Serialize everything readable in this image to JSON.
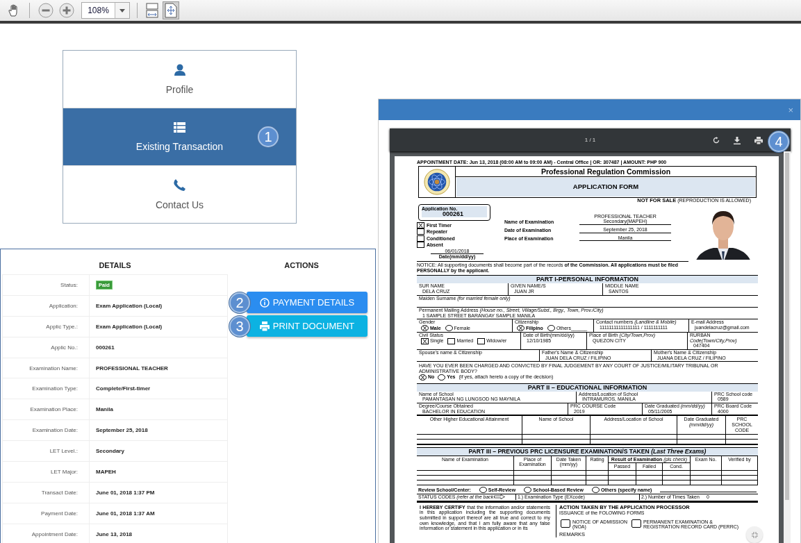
{
  "toolbar": {
    "zoom": "108%",
    "view_buttons": [
      {
        "selected": false
      },
      {
        "selected": true
      }
    ]
  },
  "menu": [
    {
      "label": "Profile",
      "selected": false
    },
    {
      "label": "Existing Transaction",
      "selected": true,
      "callout": "1"
    },
    {
      "label": "Contact Us",
      "selected": false
    }
  ],
  "details": {
    "heading": "DETAILS",
    "rows": [
      {
        "label": "Status:",
        "value": "Paid",
        "kind": "badge"
      },
      {
        "label": "Application:",
        "value": "Exam Application (Local)",
        "kind": "text"
      },
      {
        "label": "Applic Type.:",
        "value": "Exam Application (Local)",
        "kind": "text"
      },
      {
        "label": "Applic No.:",
        "value": "000261",
        "kind": "text"
      },
      {
        "label": "Examination Name:",
        "value": "PROFESSIONAL TEACHER",
        "kind": "text"
      },
      {
        "label": "Examination Type:",
        "value": "Complete/First-timer",
        "kind": "text"
      },
      {
        "label": "Examination Place:",
        "value": "Manila",
        "kind": "text"
      },
      {
        "label": "Examination Date:",
        "value": "September 25, 2018",
        "kind": "text"
      },
      {
        "label": "LET Level.:",
        "value": "Secondary",
        "kind": "text"
      },
      {
        "label": "LET Major:",
        "value": "MAPEH",
        "kind": "text"
      },
      {
        "label": "Transact Date:",
        "value": "June 01, 2018 1:37 PM",
        "kind": "text"
      },
      {
        "label": "Payment Date:",
        "value": "June 01, 2018 1:37 AM",
        "kind": "text"
      },
      {
        "label": "Appointment Date:",
        "value": "June 13, 2018",
        "kind": "text"
      }
    ]
  },
  "actions": {
    "heading": "ACTIONS",
    "buttons": [
      {
        "label": "PAYMENT DETAILS",
        "kind": "info",
        "callout": "2"
      },
      {
        "label": "PRINT DOCUMENT",
        "kind": "print",
        "callout": "3"
      }
    ]
  },
  "modal": {
    "close": "×"
  },
  "viewer": {
    "page_indicator": "1 / 1",
    "callout": "4"
  },
  "document": {
    "appointment": "APPOINTMENT DATE: Jun 13, 2018 (08:00 AM to 09:00 AM) - Central Office | OR: 307487 | AMOUNT: PHP 900",
    "organization": "Professional Regulation Commission",
    "form_title": "APPLICATION FORM",
    "not_for_sale": "NOT FOR SALE",
    "reproduction_note": "(REPRODUCTION IS ALLOWED)",
    "application_no_label": "Application  No.",
    "application_no": "000261",
    "applicant_types": [
      {
        "label": "First Timer",
        "checked": true
      },
      {
        "label": "Repeater",
        "checked": false
      },
      {
        "label": "Conditioned",
        "checked": false
      },
      {
        "label": "Absent",
        "checked": false
      }
    ],
    "date_value": "06/01/2018",
    "date_label": "Date(mm/dd/yy)",
    "exam_fields": [
      {
        "label": "Name of Examination",
        "values": [
          "PROFESSIONAL TEACHER",
          "Secondary(MAPEH)"
        ]
      },
      {
        "label": "Date of Examination",
        "values": [
          "September 25, 2018"
        ]
      },
      {
        "label": "Place of Examination",
        "values": [
          "Manila"
        ]
      }
    ],
    "notice": "NOTICE: All supporting documents shall become part of the records **of the Commission. All applications must be filed PERSONALLY by the applicant.**",
    "part1_title": "PART I-PERSONAL INFORMATION",
    "personal_rows": [
      {
        "cells": [
          {
            "kind": "field",
            "label": "SUR NAME",
            "value": "DELA CRUZ"
          },
          {
            "kind": "field",
            "label": "GIVEN NAME/S",
            "value": "JUAN JR"
          },
          {
            "kind": "field",
            "label": "MIDDLE NAME",
            "value": "SANTOS"
          }
        ]
      },
      {
        "cells": [
          {
            "kind": "field",
            "label": "Maiden Surname *(for married female only)*"
          }
        ]
      },
      {
        "cells": [
          {
            "kind": "field",
            "label": "Permanent Mailing Address *(House no., Street, Village/Subd., Brgy., Town, Prov./City)*",
            "value": "1 SAMPLE STREET BARANGAY SAMPLE MANILA"
          }
        ]
      },
      {
        "cells": [
          {
            "kind": "radio",
            "label": "Gender",
            "options": [
              {
                "label": "Male",
                "checked": true
              },
              {
                "label": "Female",
                "checked": false
              }
            ]
          },
          {
            "kind": "radio",
            "label": "Citizenship",
            "options": [
              {
                "label": "Filipino",
                "checked": true
              },
              {
                "label": "Others______",
                "checked": false
              }
            ]
          },
          {
            "kind": "field",
            "label": "Contact numbers *(Landline & Mobile)*",
            "value": "11111111111111111 / 1111111111"
          },
          {
            "kind": "field",
            "label": "E-mail Address",
            "value": "juandelacruz@gmail.com"
          }
        ]
      },
      {
        "cells": [
          {
            "kind": "box",
            "label": "Civil Status",
            "options": [
              {
                "label": "Single",
                "checked": true
              },
              {
                "label": "Married",
                "checked": false
              },
              {
                "label": "Widow/er",
                "checked": false
              }
            ]
          },
          {
            "kind": "field",
            "label": "Date of Birth(mm/dd/yy)",
            "value": "12/10/1985"
          },
          {
            "kind": "field",
            "label": "Place of Birth *(City/Town,Prov)*",
            "value": "QUEZON CITY"
          },
          {
            "kind": "field",
            "label": "RURBAN *Code(Town/City,Prov)*",
            "value": "047404"
          }
        ]
      },
      {
        "cells": [
          {
            "kind": "field",
            "label": "Spouse's name & Citizenship"
          },
          {
            "kind": "field",
            "label": "Father's Name & Citizenship",
            "value": "JUAN DELA CRUZ / FILIPINO"
          },
          {
            "kind": "field",
            "label": "Mother's Name & Citizenship",
            "value": "JUANA DELA CRUZ / FILIPINO"
          }
        ]
      }
    ],
    "conviction": {
      "question": "HAVE  YOU EVER BEEN CHARGED AND CONVICTED BY FINAL JUDGEMENT BY ANY COURT OF JUSTICE/MILITARY TRIBUNAL OR ADMINISTRATIVE BODY?",
      "options": [
        {
          "label": "No",
          "checked": true
        },
        {
          "label": "Yes",
          "checked": false
        }
      ],
      "note": "(If yes, attach hereto a copy of the decision)"
    },
    "part2_title": "PART II – EDUCATIONAL INFORMATION",
    "education_rows": [
      {
        "cells": [
          {
            "kind": "field",
            "label": "Name of School",
            "value": "PAMANTASAN NG LUNGSOD NG MAYNILA"
          },
          {
            "kind": "field",
            "label": "Address/Location of School",
            "value": "INTRAMUROS, MANILA"
          },
          {
            "kind": "field",
            "label": "PRC School code",
            "value": "0589"
          }
        ]
      },
      {
        "cells": [
          {
            "kind": "field",
            "label": "Degree/Course Obtained",
            "value": "BACHELOR IN EDUCATION"
          },
          {
            "kind": "field",
            "label": "PRC COURSE Code",
            "value": "2019"
          },
          {
            "kind": "field",
            "label": "Date Graduated *(mm/dd/yy)*",
            "value": "05/11/2005"
          },
          {
            "kind": "field",
            "label": "PRC Board Code",
            "value": "4000"
          }
        ]
      }
    ],
    "higher_education_columns": [
      "Other Higher Educational Attainment",
      "Name of School",
      "Address/Location of School",
      "Date Graduated *(mm/dd/yy)*",
      "PRC SCHOOL CODE"
    ],
    "part3_title": "PART III – PREVIOUS PRC LICENSURE EXAMINATION/S TAKEN *(Last Three Exams)*",
    "exam_columns": [
      "Name of Examination",
      "Place of Examination",
      "Date Taken (mm/yy)",
      "Rating",
      "Exam No.",
      "Verified by"
    ],
    "result_heading": "**Result of Examination** *(pls check)*",
    "result_columns": [
      "Passed",
      "Failed",
      "Cond."
    ],
    "review": {
      "label": "Review School/Center:",
      "options": [
        {
          "label": "Self-Review",
          "checked": false
        },
        {
          "label": "School-Based Review",
          "checked": false
        },
        {
          "label": "Others (specify name)",
          "checked": false
        }
      ]
    },
    "status_codes": {
      "label": "STATUS CODES *(refer at the back*",
      "exam_type": "1.) Examination Type (EXcode)",
      "times_label": "2.) Number of Times Taken",
      "times_value": "0"
    },
    "certify": "**I  HEREBY  CERTIFY**  that  the  information  and/or statements in this application including the supporting documents submitted in support thereof are all true and correct to my own knowledge, and that I am fully aware that any false information or statement in this application or in its",
    "action_title": "ACTION TAKEN BY THE APPLICATION PROCESSOR",
    "issuance": "ISSUANCE of the FOLOWING FORMS",
    "forms": [
      {
        "label": "NOTICE OF ADMISSION",
        "sub": "(NOA)",
        "checked": false
      },
      {
        "label": "PERMANENT EXAMINATION &",
        "sub": "REGISTRATION RECORD CARD (PERRC)",
        "checked": false
      }
    ],
    "remarks": "REMARKS"
  }
}
